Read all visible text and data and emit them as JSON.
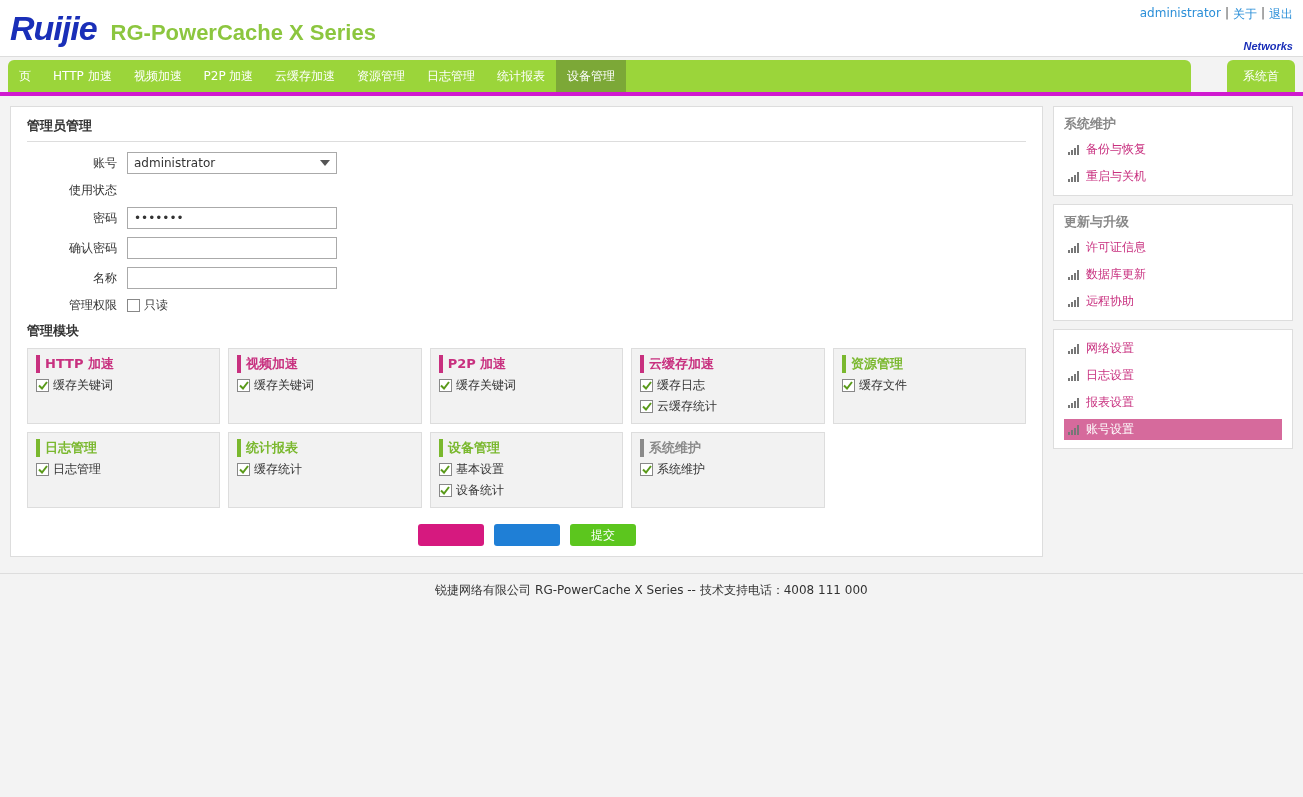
{
  "top_links": {
    "items": [
      "administrator",
      "关于",
      "退出"
    ],
    "separator": "|"
  },
  "logo": {
    "brand": "Ruijie",
    "product": "RG-PowerCache X Series",
    "tagline": "Networks"
  },
  "nav": {
    "tabs": [
      {
        "label": "页",
        "selected": false
      },
      {
        "label": "HTTP 加速",
        "selected": false
      },
      {
        "label": "视频加速",
        "selected": false
      },
      {
        "label": "P2P 加速",
        "selected": false
      },
      {
        "label": "云缓存加速",
        "selected": false
      },
      {
        "label": "资源管理",
        "selected": false
      },
      {
        "label": "日志管理",
        "selected": false
      },
      {
        "label": "统计报表",
        "selected": false
      },
      {
        "label": "设备管理",
        "selected": true
      }
    ],
    "home": "系统首"
  },
  "page_title": "管理员管理",
  "form": [
    {
      "label": "账号",
      "kind": "select",
      "value": "administrator"
    },
    {
      "label": "使用状态",
      "kind": "static"
    },
    {
      "label": "密码",
      "kind": "password",
      "value": "•••••••"
    },
    {
      "label": "确认密码",
      "kind": "password"
    },
    {
      "label": "名称",
      "kind": "text"
    }
  ],
  "permissions": {
    "label": "管理权限",
    "readonly": {
      "label": "只读",
      "checked": false
    },
    "modules_label": "管理模块",
    "modules": [
      {
        "title": "HTTP 加速",
        "color": "#c8307f",
        "items": [
          {
            "label": "缓存关键词",
            "checked": true
          }
        ]
      },
      {
        "title": "视频加速",
        "color": "#c8307f",
        "items": [
          {
            "label": "缓存关键词",
            "checked": true
          }
        ]
      },
      {
        "title": "P2P 加速",
        "color": "#c8307f",
        "items": [
          {
            "label": "缓存关键词",
            "checked": true
          }
        ]
      },
      {
        "title": "云缓存加速",
        "color": "#c8307f",
        "items": [
          {
            "label": "缓存日志",
            "checked": true
          },
          {
            "label": "云缓存统计",
            "checked": true
          }
        ]
      },
      {
        "title": "资源管理",
        "color": "#7ab82e",
        "items": [
          {
            "label": "缓存文件",
            "checked": true
          }
        ]
      },
      {
        "title": "日志管理",
        "color": "#7ab82e",
        "items": [
          {
            "label": "日志管理",
            "checked": true
          }
        ]
      },
      {
        "title": "统计报表",
        "color": "#7ab82e",
        "items": [
          {
            "label": "缓存统计",
            "checked": true
          }
        ]
      },
      {
        "title": "设备管理",
        "color": "#7ab82e",
        "items": [
          {
            "label": "基本设置",
            "checked": true
          },
          {
            "label": "设备统计",
            "checked": true
          }
        ]
      },
      {
        "title": "系统维护",
        "color": "#8a8a8a",
        "items": [
          {
            "label": "系统维护",
            "checked": true
          }
        ]
      }
    ]
  },
  "buttons": [
    {
      "kind": "reset"
    },
    {
      "kind": "confirm"
    },
    {
      "kind": "submit",
      "label": "提交"
    }
  ],
  "sidebar": [
    {
      "title": "系统维护",
      "items": [
        {
          "label": "备份与恢复",
          "selected": false
        },
        {
          "label": "重启与关机",
          "selected": false
        }
      ]
    },
    {
      "title": "更新与升级",
      "items": [
        {
          "label": "许可证信息",
          "selected": false
        },
        {
          "label": "数据库更新",
          "selected": false
        },
        {
          "label": "远程协助",
          "selected": false
        }
      ]
    },
    {
      "items": [
        {
          "label": "网络设置",
          "selected": false
        },
        {
          "label": "日志设置",
          "selected": false
        },
        {
          "label": "报表设置",
          "selected": false
        },
        {
          "label": "账号设置",
          "selected": true
        }
      ]
    }
  ],
  "footer": "锐捷网络有限公司  RG-PowerCache X Series -- 技术支持电话：4008 111 000"
}
